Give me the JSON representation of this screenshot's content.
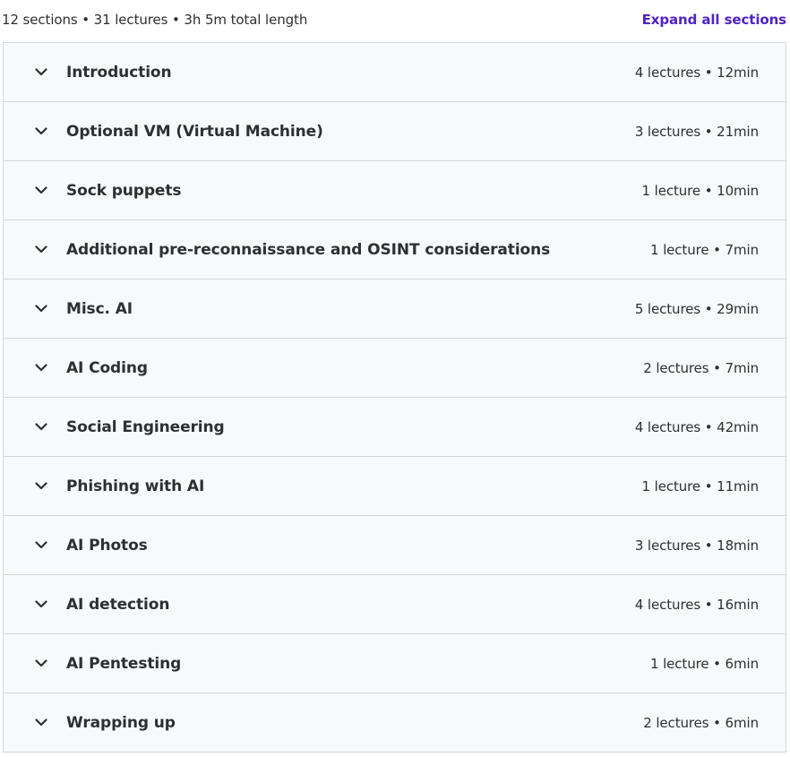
{
  "summary": {
    "text": "12 sections • 31 lectures • 3h 5m total length",
    "expand_label": "Expand all sections"
  },
  "sections": [
    {
      "title": "Introduction",
      "meta": "4 lectures • 12min"
    },
    {
      "title": "Optional VM (Virtual Machine)",
      "meta": "3 lectures • 21min"
    },
    {
      "title": "Sock puppets",
      "meta": "1 lecture • 10min"
    },
    {
      "title": "Additional pre-reconnaissance and OSINT considerations",
      "meta": "1 lecture • 7min"
    },
    {
      "title": "Misc. AI",
      "meta": "5 lectures • 29min"
    },
    {
      "title": "AI Coding",
      "meta": "2 lectures • 7min"
    },
    {
      "title": "Social Engineering",
      "meta": "4 lectures • 42min"
    },
    {
      "title": "Phishing with AI",
      "meta": "1 lecture • 11min"
    },
    {
      "title": "AI Photos",
      "meta": "3 lectures • 18min"
    },
    {
      "title": "AI detection",
      "meta": "4 lectures • 16min"
    },
    {
      "title": "AI Pentesting",
      "meta": "1 lecture • 6min"
    },
    {
      "title": "Wrapping up",
      "meta": "2 lectures • 6min"
    }
  ],
  "icons": {
    "section_toggle": "chevron-down-icon"
  },
  "colors": {
    "link": "#5022c3",
    "text": "#2d2f31",
    "row_background": "#f7f9fa",
    "border": "#d1d7dc"
  }
}
